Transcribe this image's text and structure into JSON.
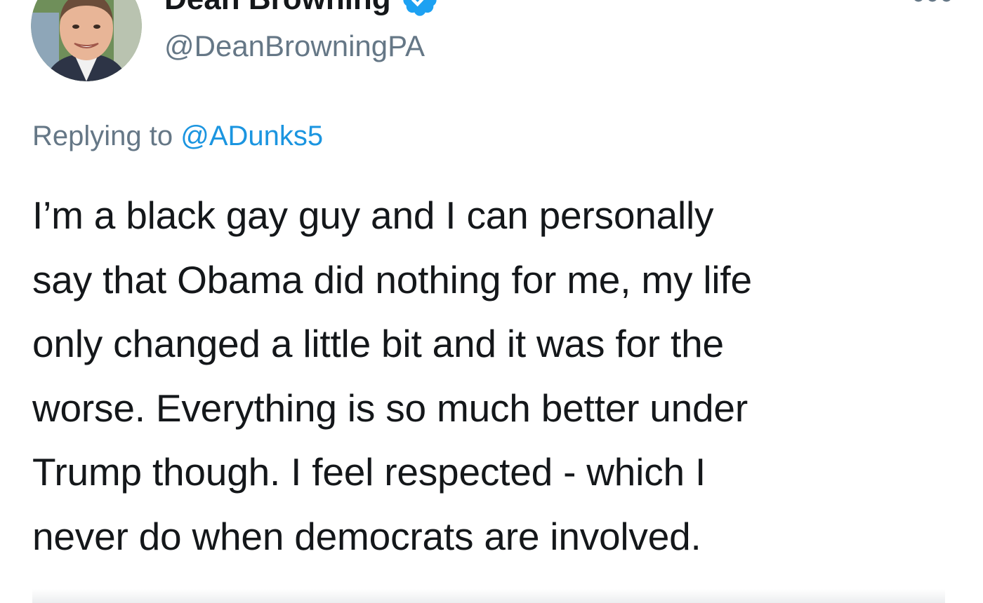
{
  "author": {
    "display_name": "Dean Browning",
    "handle": "@DeanBrowningPA",
    "verified": true
  },
  "reply": {
    "prefix": "Replying to",
    "to_handle": "@ADunks5"
  },
  "tweet": {
    "lines": [
      "I’m a black gay guy and I can personally",
      "say that Obama did nothing for me, my life",
      "only changed a little bit and it was for the",
      "worse. Everything is so much better under",
      "Trump though. I feel respected - which I",
      "never do when democrats are involved."
    ]
  },
  "colors": {
    "text_primary": "#14171a",
    "text_secondary": "#657786",
    "link": "#1b95e0",
    "verified_badge": "#1da1f2",
    "background": "#ffffff"
  },
  "icons": {
    "verified": "verified-badge-icon",
    "more": "more-options-icon"
  }
}
